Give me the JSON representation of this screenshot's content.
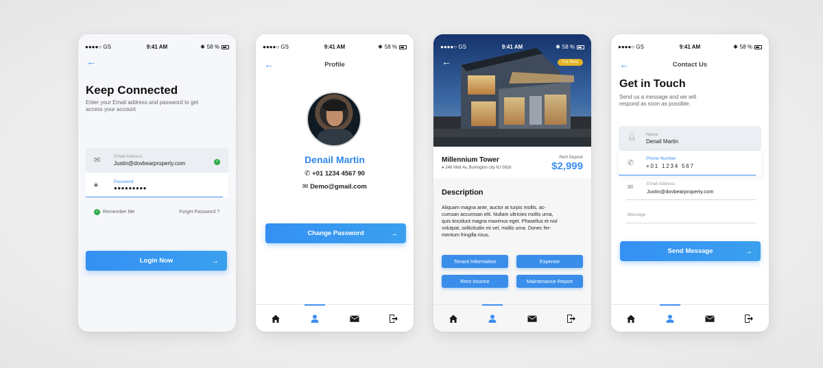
{
  "status": {
    "carrier": "●●●●○ GS",
    "time": "9:41 AM",
    "battery": "58 %"
  },
  "screen1": {
    "back": "←",
    "title": "Keep Connected",
    "subtitle": "Enter your Email address and password to get access your account",
    "email_label": "Email Address",
    "email_value": "Justin@dovbearproperty.com",
    "password_label": "Password",
    "password_value": "●●●●●●●●●",
    "remember": "Remember Me",
    "forgot": "Forget Password ?",
    "login": "Login Now",
    "arrow": "→"
  },
  "screen2": {
    "back": "←",
    "title": "Profile",
    "name": "Denail Martin",
    "phone": "+01 1234 4567 90",
    "email": "Demo@gmail.com",
    "change_password": "Change Password",
    "arrow": "→"
  },
  "screen3": {
    "back": "←",
    "badge": "For Rent",
    "property_name": "Millennium Tower",
    "address": "246 Mott Av, Burlington city NJ 0816",
    "deposit_label": "Rent Deposit",
    "deposit_value": "$2,999",
    "desc_title": "Description",
    "desc_lines": [
      "Aliquam magna ante, auctor at turpis mollis, ac-",
      "cumsan accumsan elit. Nullam ultricies mollis urna,",
      "quis tincidunt magna maximus eget. Phasellus et nisl",
      "volutpat, sollicitudin mi vel, mollis urna. Donec fer-",
      "mentum fringilla risus."
    ],
    "buttons": [
      "Tenant Information",
      "Expense",
      "Rent Income",
      "Maintenance Report"
    ]
  },
  "screen4": {
    "back": "←",
    "title": "Contact Us",
    "heading": "Get in Touch",
    "subtitle_lines": [
      "Send us a message and we will",
      "respond as soon as possible."
    ],
    "name_label": "Name",
    "name_value": "Denail Martin",
    "phone_label": "Phone Number",
    "phone_value": "+01 1234 567",
    "email_label": "Email Address",
    "email_value": "Justin@dovbearproperty.com",
    "message_label": "Message",
    "send": "Send Message",
    "arrow": "→"
  },
  "colors": {
    "accent": "#3d8ff0",
    "success": "#2eaa4a",
    "badge": "#e3b323",
    "heading": "#111111"
  },
  "tabbar_icons": [
    "home-icon",
    "user-icon",
    "mail-icon",
    "logout-icon"
  ]
}
